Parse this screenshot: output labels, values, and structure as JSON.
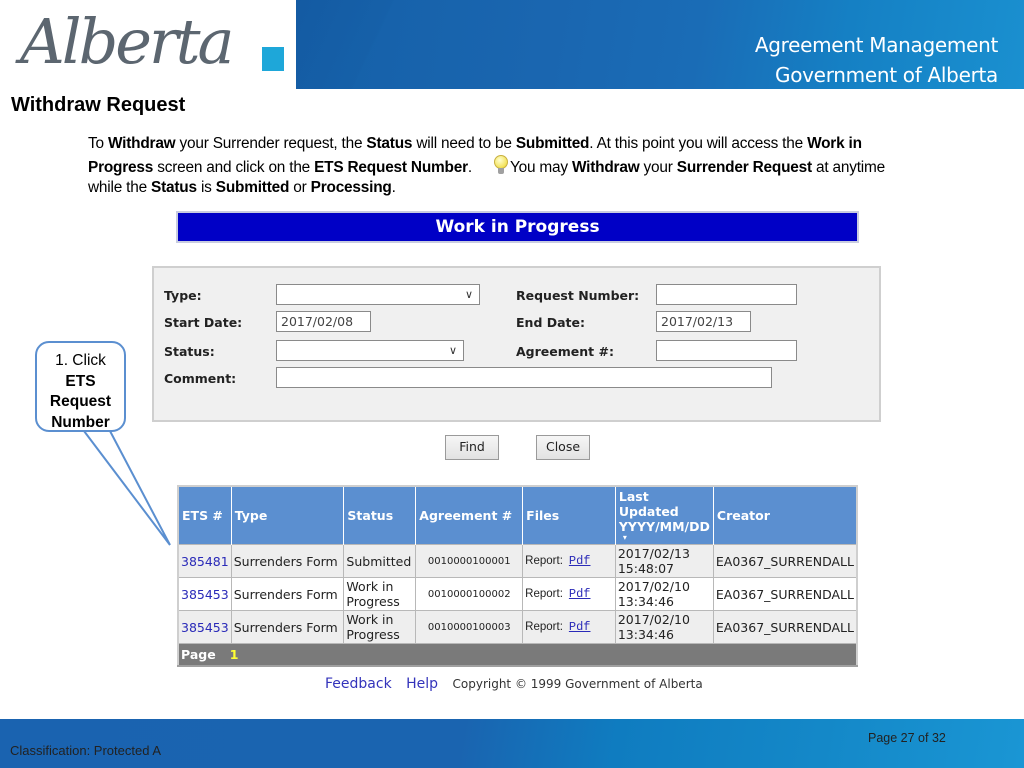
{
  "header": {
    "logo_text": "Alberta",
    "title_line1": "Agreement Management",
    "title_line2": "Government of Alberta"
  },
  "slide": {
    "title": "Withdraw Request",
    "instructions": [
      {
        "text": "To ",
        "bold": false
      },
      {
        "text": "Withdraw",
        "bold": true
      },
      {
        "text": " your Surrender request, the ",
        "bold": false
      },
      {
        "text": "Status",
        "bold": true
      },
      {
        "text": " will need to be ",
        "bold": false
      },
      {
        "text": "Submitted",
        "bold": true
      },
      {
        "text": ".  At this point you will access the ",
        "bold": false
      },
      {
        "text": "Work in Progress",
        "bold": true
      },
      {
        "text": " screen and click on the ",
        "bold": false
      },
      {
        "text": "ETS Request Number",
        "bold": true
      },
      {
        "text": ".",
        "bold": false
      },
      {
        "text": "__BULB__",
        "bold": false
      },
      {
        "text": "You may ",
        "bold": false
      },
      {
        "text": "Withdraw",
        "bold": true
      },
      {
        "text": " your ",
        "bold": false
      },
      {
        "text": "Surrender Request",
        "bold": true
      },
      {
        "text": "  at anytime while the ",
        "bold": false
      },
      {
        "text": "Status",
        "bold": true
      },
      {
        "text": " is ",
        "bold": false
      },
      {
        "text": "Submitted",
        "bold": true
      },
      {
        "text": " or ",
        "bold": false
      },
      {
        "text": "Processing",
        "bold": true
      },
      {
        "text": ".",
        "bold": false
      }
    ],
    "tip_icon": "lightbulb-icon"
  },
  "app": {
    "banner_title": "Work in Progress",
    "form": {
      "type_label": "Type:",
      "type_value": "",
      "start_date_label": "Start Date:",
      "start_date_value": "2017/02/08",
      "status_label": "Status:",
      "status_value": "",
      "comment_label": "Comment:",
      "comment_value": "",
      "request_number_label": "Request Number:",
      "request_number_value": "",
      "end_date_label": "End Date:",
      "end_date_value": "2017/02/13",
      "agreement_label": "Agreement #:",
      "agreement_value": ""
    },
    "buttons": {
      "find": "Find",
      "close": "Close"
    },
    "table": {
      "columns": [
        "ETS #",
        "Type",
        "Status",
        "Agreement #",
        "Files",
        "Last Updated YYYY/MM/DD",
        "Creator"
      ],
      "sort_indicator": "▾",
      "rows": [
        {
          "ets": "385481",
          "type": "Surrenders Form",
          "status": "Submitted",
          "agreement": "0010000100001",
          "files_label": "Report:",
          "files_link": "Pdf",
          "updated_date": "2017/02/13",
          "updated_time": "15:48:07",
          "creator": "EA0367_SURRENDALL"
        },
        {
          "ets": "385453",
          "type": "Surrenders Form",
          "status": "Work in Progress",
          "agreement": "0010000100002",
          "files_label": "Report:",
          "files_link": "Pdf",
          "updated_date": "2017/02/10",
          "updated_time": "13:34:46",
          "creator": "EA0367_SURRENDALL"
        },
        {
          "ets": "385453",
          "type": "Surrenders Form",
          "status": "Work in Progress",
          "agreement": "0010000100003",
          "files_label": "Report:",
          "files_link": "Pdf",
          "updated_date": "2017/02/10",
          "updated_time": "13:34:46",
          "creator": "EA0367_SURRENDALL"
        }
      ],
      "pager_label": "Page",
      "current_page": "1"
    },
    "footer": {
      "feedback": "Feedback",
      "help": "Help",
      "copyright": "Copyright © 1999 Government of Alberta"
    }
  },
  "callout": {
    "line1": "1. Click",
    "line2": "ETS",
    "line3": "Request",
    "line4": "Number"
  },
  "bottom": {
    "classification": "Classification: Protected A",
    "page": "Page 27 of 32"
  },
  "colors": {
    "brand_blue": "#1a66b0",
    "banner_blue": "#0000c6",
    "table_header": "#5b8fd0",
    "callout_border": "#5b8fd0",
    "link": "#2a2ab8",
    "page_number": "#ffff33"
  }
}
